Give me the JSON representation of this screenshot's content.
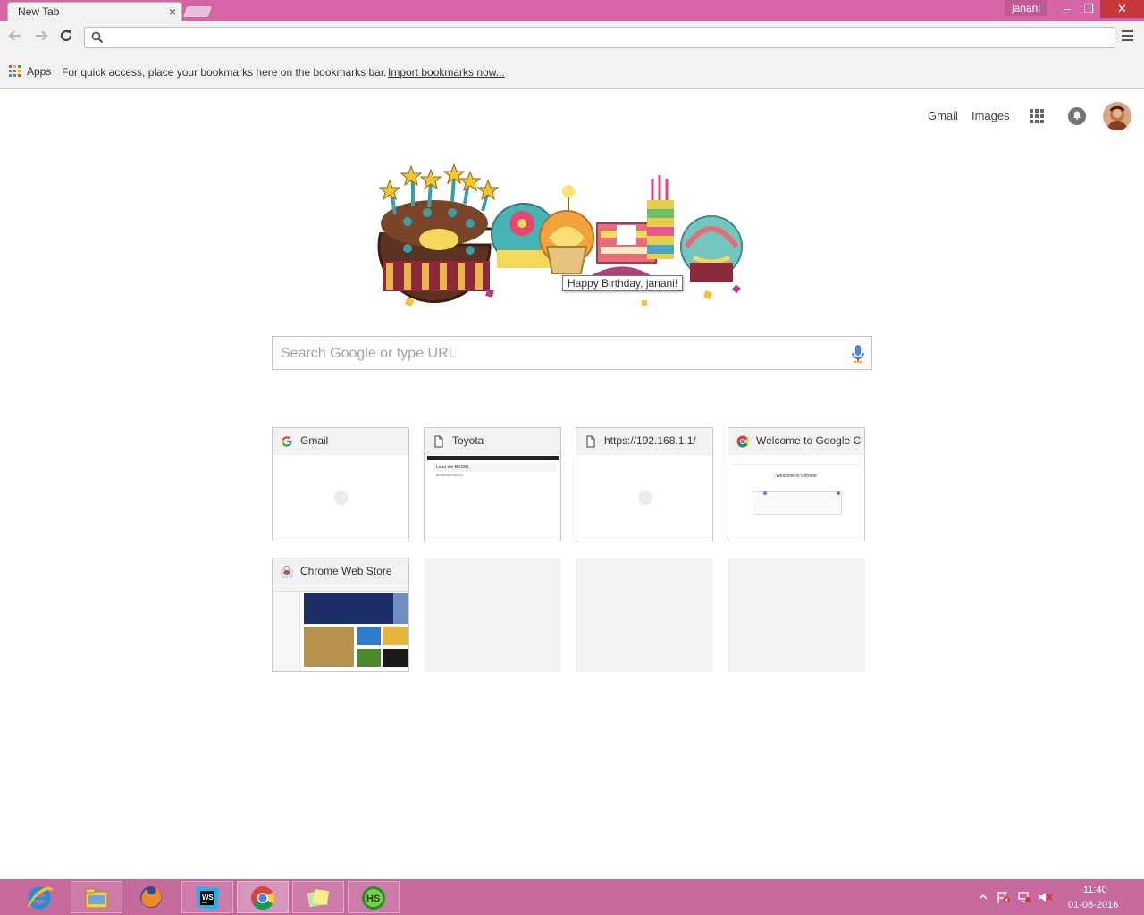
{
  "window": {
    "tab_title": "New Tab",
    "tab_close": "×",
    "profile_name": "janani",
    "btn_minimize": "–",
    "btn_restore": "❐",
    "btn_close": "✕"
  },
  "toolbar": {
    "omnibox_value": "",
    "back_icon": "arrow-left",
    "forward_icon": "arrow-right",
    "reload_icon": "reload",
    "menu_icon": "hamburger"
  },
  "bookmarks_bar": {
    "apps_label": "Apps",
    "hint": "For quick access, place your bookmarks here on the bookmarks bar.",
    "import_link": "Import bookmarks now..."
  },
  "google_bar": {
    "gmail": "Gmail",
    "images": "Images"
  },
  "doodle": {
    "tooltip": "Happy Birthday, janani!"
  },
  "search": {
    "placeholder": "Search Google or type URL"
  },
  "tiles": [
    {
      "title": "Gmail",
      "favicon": "google-g-icon"
    },
    {
      "title": "Toyota",
      "favicon": "page-icon",
      "thumb_heading": "Load the EXCEL",
      "thumb_line": "javascript:void(0)"
    },
    {
      "title": "https://192.168.1.1/",
      "favicon": "page-icon"
    },
    {
      "title": "Welcome to Google Chrome",
      "favicon": "chrome-icon",
      "thumb_heading": "Welcome to Chrome"
    },
    {
      "title": "Chrome Web Store",
      "favicon": "webstore-icon"
    }
  ],
  "taskbar": {
    "apps": [
      "internet-explorer-icon",
      "file-explorer-icon",
      "firefox-icon",
      "webstorm-icon",
      "chrome-icon",
      "sticky-notes-icon",
      "hotspot-shield-icon"
    ],
    "time": "11:40",
    "date": "01-08-2016"
  },
  "colors": {
    "frame": "#d565a4",
    "taskbar": "#c66a9e",
    "toolbar": "#f2f2f2",
    "close_button": "#c7383a"
  }
}
